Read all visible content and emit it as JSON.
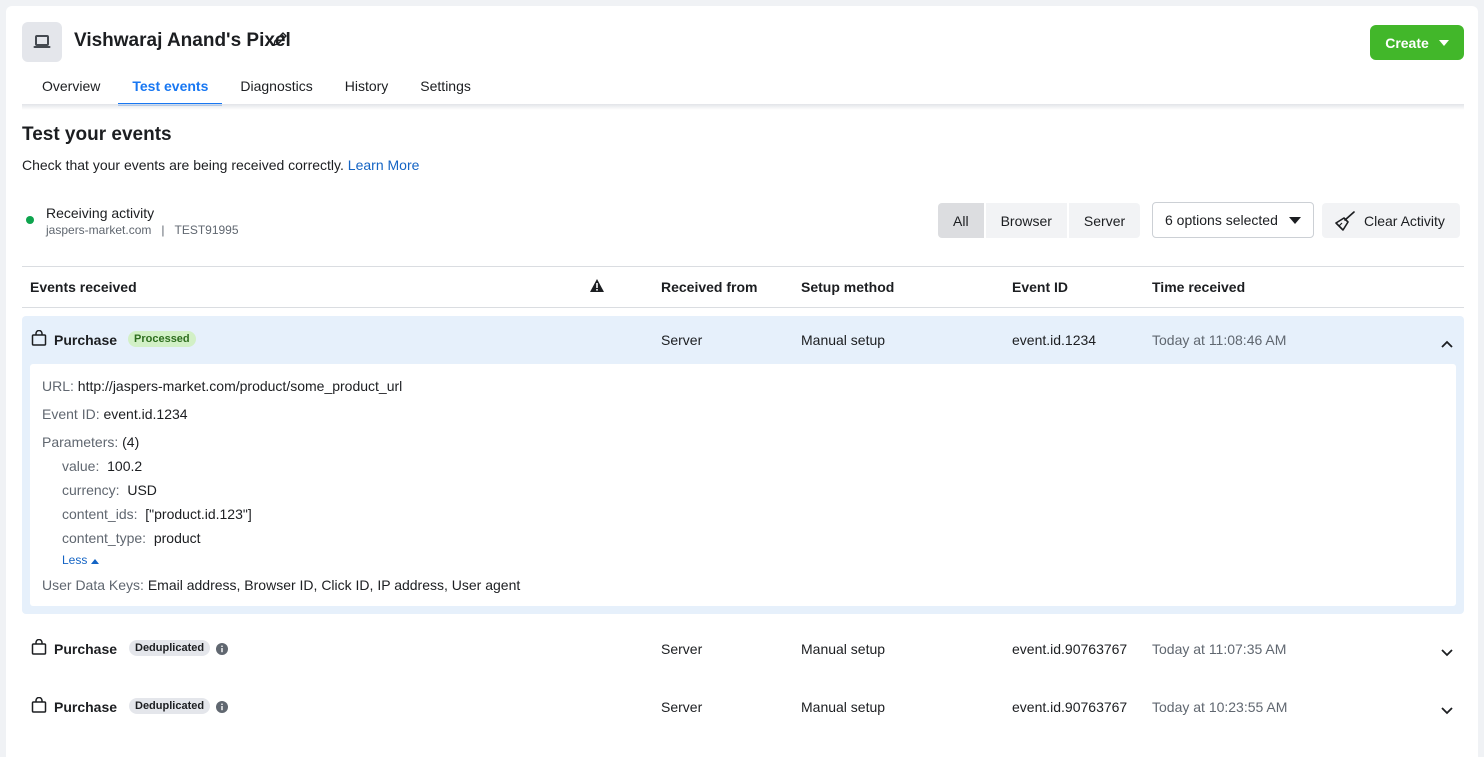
{
  "header": {
    "title": "Vishwaraj Anand's Pixel",
    "create_label": "Create"
  },
  "tabs": [
    {
      "label": "Overview"
    },
    {
      "label": "Test events"
    },
    {
      "label": "Diagnostics"
    },
    {
      "label": "History"
    },
    {
      "label": "Settings"
    }
  ],
  "active_tab": "Test events",
  "section": {
    "title": "Test your events",
    "subtitle": "Check that your events are being received correctly.",
    "learn_more": "Learn More"
  },
  "status": {
    "label": "Receiving activity",
    "domain": "jaspers-market.com",
    "separator": "|",
    "test_code": "TEST91995"
  },
  "filters": {
    "all": "All",
    "browser": "Browser",
    "server": "Server",
    "selected": "All",
    "options": "6 options selected",
    "clear": "Clear Activity"
  },
  "table": {
    "headers": {
      "events": "Events received",
      "received_from": "Received from",
      "setup_method": "Setup method",
      "event_id": "Event ID",
      "time": "Time received"
    },
    "rows": [
      {
        "event": "Purchase",
        "status": "Processed",
        "received_from": "Server",
        "setup": "Manual setup",
        "event_id": "event.id.1234",
        "time": "Today at 11:08:46 AM",
        "expanded": true
      },
      {
        "event": "Purchase",
        "status": "Deduplicated",
        "received_from": "Server",
        "setup": "Manual setup",
        "event_id": "event.id.90763767",
        "time": "Today at 11:07:35 AM",
        "expanded": false
      },
      {
        "event": "Purchase",
        "status": "Deduplicated",
        "received_from": "Server",
        "setup": "Manual setup",
        "event_id": "event.id.90763767",
        "time": "Today at 10:23:55 AM",
        "expanded": false
      }
    ]
  },
  "details": {
    "url_label": "URL:",
    "url": "http://jaspers-market.com/product/some_product_url",
    "event_id_label": "Event ID:",
    "event_id": "event.id.1234",
    "params_label": "Parameters:",
    "params_count": "(4)",
    "params": [
      {
        "key": "value:",
        "value": "100.2"
      },
      {
        "key": "currency:",
        "value": "USD"
      },
      {
        "key": "content_ids:",
        "value": "[\"product.id.123\"]"
      },
      {
        "key": "content_type:",
        "value": "product"
      }
    ],
    "less": "Less",
    "user_data_label": "User Data Keys:",
    "user_data": "Email address, Browser ID, Click ID, IP address, User agent"
  },
  "colors": {
    "accent": "#1877f2",
    "create_button": "#42b72a",
    "status_dot": "#0ea44e",
    "processed_badge": "#d2f0c6",
    "expanded_row": "#e6f0fb"
  },
  "icons": [
    "laptop-icon",
    "pencil-icon",
    "caret-down-icon",
    "broom-icon",
    "warning-icon",
    "shopping-bag-icon",
    "info-icon",
    "chevron-up-icon",
    "chevron-down-icon"
  ]
}
